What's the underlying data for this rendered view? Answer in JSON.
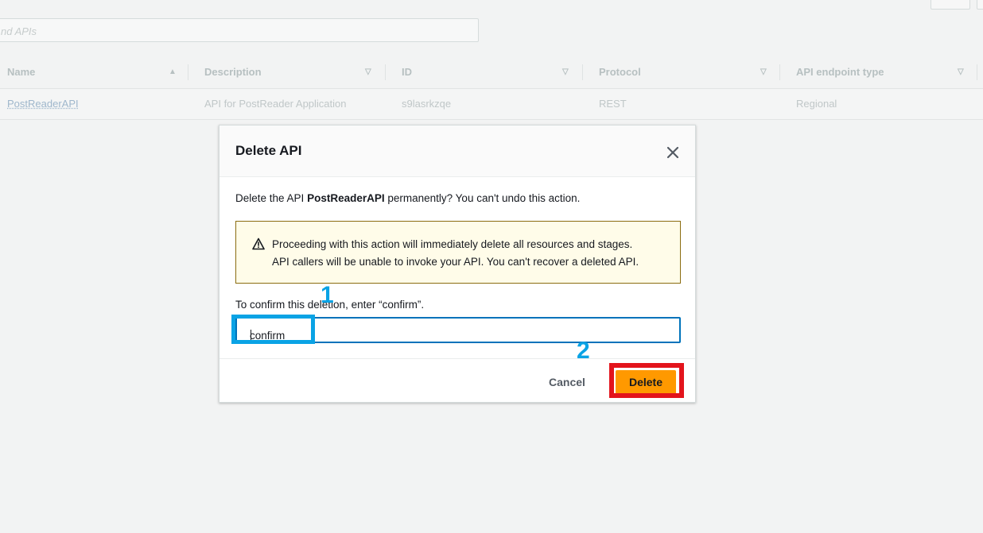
{
  "background": {
    "search_placeholder": "nd APIs",
    "columns": [
      {
        "label": "Name",
        "sort": "asc"
      },
      {
        "label": "Description"
      },
      {
        "label": "ID"
      },
      {
        "label": "Protocol"
      },
      {
        "label": "API endpoint type"
      }
    ],
    "row": {
      "name": "PostReaderAPI",
      "description": "API for PostReader Application",
      "id": "s9lasrkzqe",
      "protocol": "REST",
      "endpoint_type": "Regional"
    }
  },
  "modal": {
    "title": "Delete API",
    "question_prefix": "Delete the API ",
    "api_name": "PostReaderAPI",
    "question_suffix": " permanently? You can't undo this action.",
    "warning_line1": "Proceeding with this action will immediately delete all resources and stages.",
    "warning_line2": "API callers will be unable to invoke your API. You can't recover a deleted API.",
    "confirm_label": "To confirm this deletion, enter “confirm”.",
    "confirm_value": "confirm",
    "cancel_label": "Cancel",
    "delete_label": "Delete"
  },
  "annotations": {
    "step1": "1",
    "step2": "2"
  },
  "colors": {
    "accent_blue": "#0073bb",
    "delete_orange": "#ff9900",
    "annotation_blue": "#0aa3e5",
    "annotation_red": "#e3141c",
    "warning_bg": "#fffce9"
  }
}
